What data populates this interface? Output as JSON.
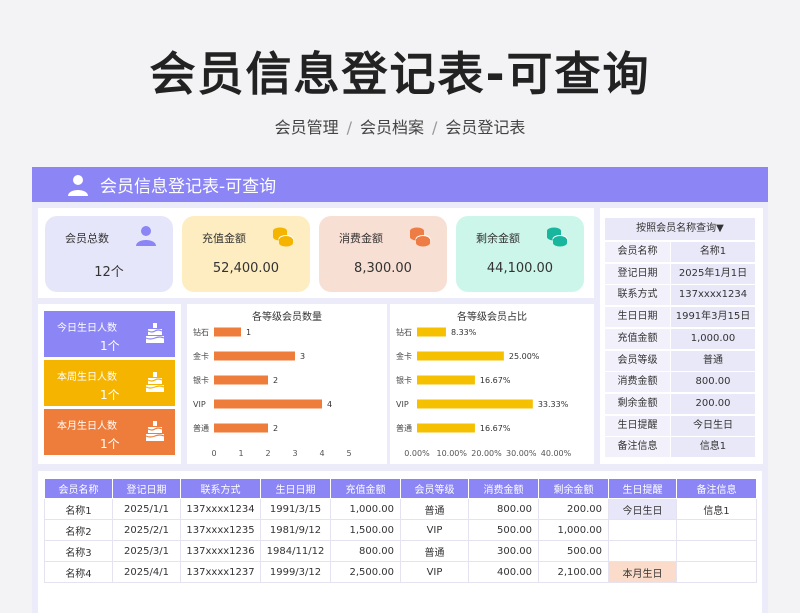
{
  "header": {
    "title": "会员信息登记表-可查询",
    "breadcrumb": [
      "会员管理",
      "会员档案",
      "会员登记表"
    ],
    "separator": "/"
  },
  "banner": {
    "title": "会员信息登记表-可查询",
    "icon": "user-icon"
  },
  "stats": [
    {
      "label": "会员总数",
      "value": "12个",
      "bg": "#e6e6fa",
      "icon": "person-icon",
      "icon_color": "#8b85f5"
    },
    {
      "label": "充值金额",
      "value": "52,400.00",
      "bg": "#fdedc0",
      "icon": "coins-icon",
      "icon_color": "#f5b400"
    },
    {
      "label": "消费金额",
      "value": "8,300.00",
      "bg": "#f8dfd4",
      "icon": "coins-icon",
      "icon_color": "#ee7d45"
    },
    {
      "label": "剩余金额",
      "value": "44,100.00",
      "bg": "#cdf6ea",
      "icon": "coins-icon",
      "icon_color": "#19b69e"
    }
  ],
  "birthdays": [
    {
      "label": "今日生日人数",
      "value": "1个",
      "bg": "#8b85f5",
      "icon": "cake-icon"
    },
    {
      "label": "本周生日人数",
      "value": "1个",
      "bg": "#f5b400",
      "icon": "cake-icon"
    },
    {
      "label": "本月生日人数",
      "value": "1个",
      "bg": "#ee7d3b",
      "icon": "cake-icon"
    }
  ],
  "colors": {
    "accent": "#8b85f5",
    "bar_count": "#ee7d3b",
    "bar_ratio": "#f5c000"
  },
  "chart_data": [
    {
      "type": "bar",
      "orientation": "horizontal",
      "title": "各等级会员数量",
      "categories": [
        "钻石",
        "金卡",
        "银卡",
        "VIP",
        "普通"
      ],
      "values": [
        1,
        3,
        2,
        4,
        2
      ],
      "labels": [
        "1",
        "3",
        "2",
        "4",
        "2"
      ],
      "xlim": [
        0,
        5
      ],
      "ticks": [
        "0",
        "1",
        "2",
        "3",
        "4",
        "5"
      ],
      "grid": false
    },
    {
      "type": "bar",
      "orientation": "horizontal",
      "title": "各等级会员占比",
      "categories": [
        "钻石",
        "金卡",
        "银卡",
        "VIP",
        "普通"
      ],
      "values": [
        8.33,
        25.0,
        16.67,
        33.33,
        16.67
      ],
      "labels": [
        "8.33%",
        "25.00%",
        "16.67%",
        "33.33%",
        "16.67%"
      ],
      "xlim": [
        0,
        40
      ],
      "ticks": [
        "0.00%",
        "10.00%",
        "20.00%",
        "30.00%",
        "40.00%"
      ],
      "grid": false
    }
  ],
  "search": {
    "header": "按照会员名称查询▼",
    "fields": [
      {
        "label": "会员名称",
        "value": "名称1"
      },
      {
        "label": "登记日期",
        "value": "2025年1月1日"
      },
      {
        "label": "联系方式",
        "value": "137xxxx1234"
      },
      {
        "label": "生日日期",
        "value": "1991年3月15日"
      },
      {
        "label": "充值金额",
        "value": "1,000.00"
      },
      {
        "label": "会员等级",
        "value": "普通"
      },
      {
        "label": "消费金额",
        "value": "800.00"
      },
      {
        "label": "剩余金额",
        "value": "200.00"
      },
      {
        "label": "生日提醒",
        "value": "今日生日"
      },
      {
        "label": "备注信息",
        "value": "信息1"
      }
    ]
  },
  "table": {
    "columns": [
      "会员名称",
      "登记日期",
      "联系方式",
      "生日日期",
      "充值金额",
      "会员等级",
      "消费金额",
      "剩余金额",
      "生日提醒",
      "备注信息"
    ],
    "rows": [
      [
        "名称1",
        "2025/1/1",
        "137xxxx1234",
        "1991/3/15",
        "1,000.00",
        "普通",
        "800.00",
        "200.00",
        "今日生日",
        "信息1"
      ],
      [
        "名称2",
        "2025/2/1",
        "137xxxx1235",
        "1981/9/12",
        "1,500.00",
        "VIP",
        "500.00",
        "1,000.00",
        "",
        ""
      ],
      [
        "名称3",
        "2025/3/1",
        "137xxxx1236",
        "1984/11/12",
        "800.00",
        "普通",
        "300.00",
        "500.00",
        "",
        ""
      ],
      [
        "名称4",
        "2025/4/1",
        "137xxxx1237",
        "1999/3/12",
        "2,500.00",
        "VIP",
        "400.00",
        "2,100.00",
        "本月生日",
        ""
      ]
    ]
  }
}
